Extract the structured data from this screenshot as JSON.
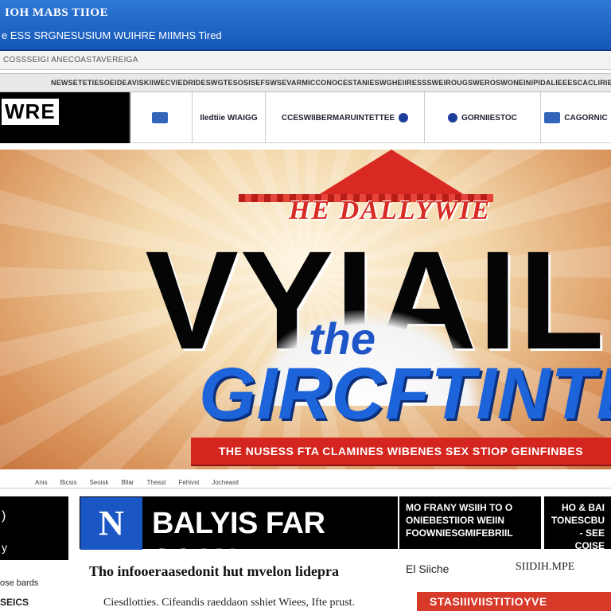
{
  "titlebar": {
    "title": "IOH MABS TIIOE",
    "subtitle": "e ESS SRGNESUSIUM WUIHRE MIIMHS Tired"
  },
  "addressbar": {
    "text": "COSSSEIGI ANECOASTAVEREIGA"
  },
  "nav": {
    "items": [
      "NEWSE",
      "TETIE",
      "SOEIDE",
      "AVISKIIWE",
      "CVIEDRIDES",
      "WGTES",
      "OSISEFS",
      "WSEVAR",
      "MIC",
      "CONOCESTANIES",
      "WGHE",
      "IIRES",
      "SSWEIROUGS",
      "WEROS",
      "WONE",
      "INIPIDALIEEES",
      "CACLIRIES"
    ]
  },
  "logo": {
    "text": "WRE"
  },
  "partners": [
    {
      "label": "",
      "icon": "badge-icon"
    },
    {
      "label": "Iledtiie WIAIGG",
      "icon": ""
    },
    {
      "label": "CCESWIIBERMARUINTETTEE",
      "icon": "globe-icon"
    },
    {
      "label": "GORNIIESTOC",
      "icon": "globe-icon"
    },
    {
      "label": "CAGORNIC",
      "icon": "badge-icon"
    }
  ],
  "hero": {
    "banner_top": "HE DALLYWIE",
    "big_word": "VYIAIL",
    "the_word": "the",
    "second_word": "GIRCFTINTE",
    "ribbon": "THE NUSESS FTA CLAMINES WIBENES SEX STIOP GEINFINBES"
  },
  "subnav": {
    "items": [
      "Anis",
      "Bicsis",
      "Seoisk",
      "Bllar",
      "Thesst",
      "Fehivst",
      "Jocheasit"
    ]
  },
  "content": {
    "left_glyph1": ")",
    "left_glyph2": "y",
    "left_text1": "ose bards",
    "left_text2": "SEICS",
    "n_badge": "N",
    "headline": "BALYIS FAR SCAN",
    "side_a": [
      "MO FRANY WSIIH TO O",
      "ONIEBESTIIOR WEIIN",
      "FOOWNIESGMIFEBRIIL"
    ],
    "side_b": [
      "HO & BAI",
      "TONESCBU",
      "- SEE COISE"
    ],
    "story_title": "Tho infooeraasedonit hut mvelon lidepra",
    "story_sub": "Ciesdlotties. Cifeandis raeddaon sshiet Wiees, Ifte prust.",
    "right_label1": "El Siiche",
    "right_label2": "SIIDIH.MPE",
    "red_strip": "STASIIIVIISTITIOYVE"
  }
}
